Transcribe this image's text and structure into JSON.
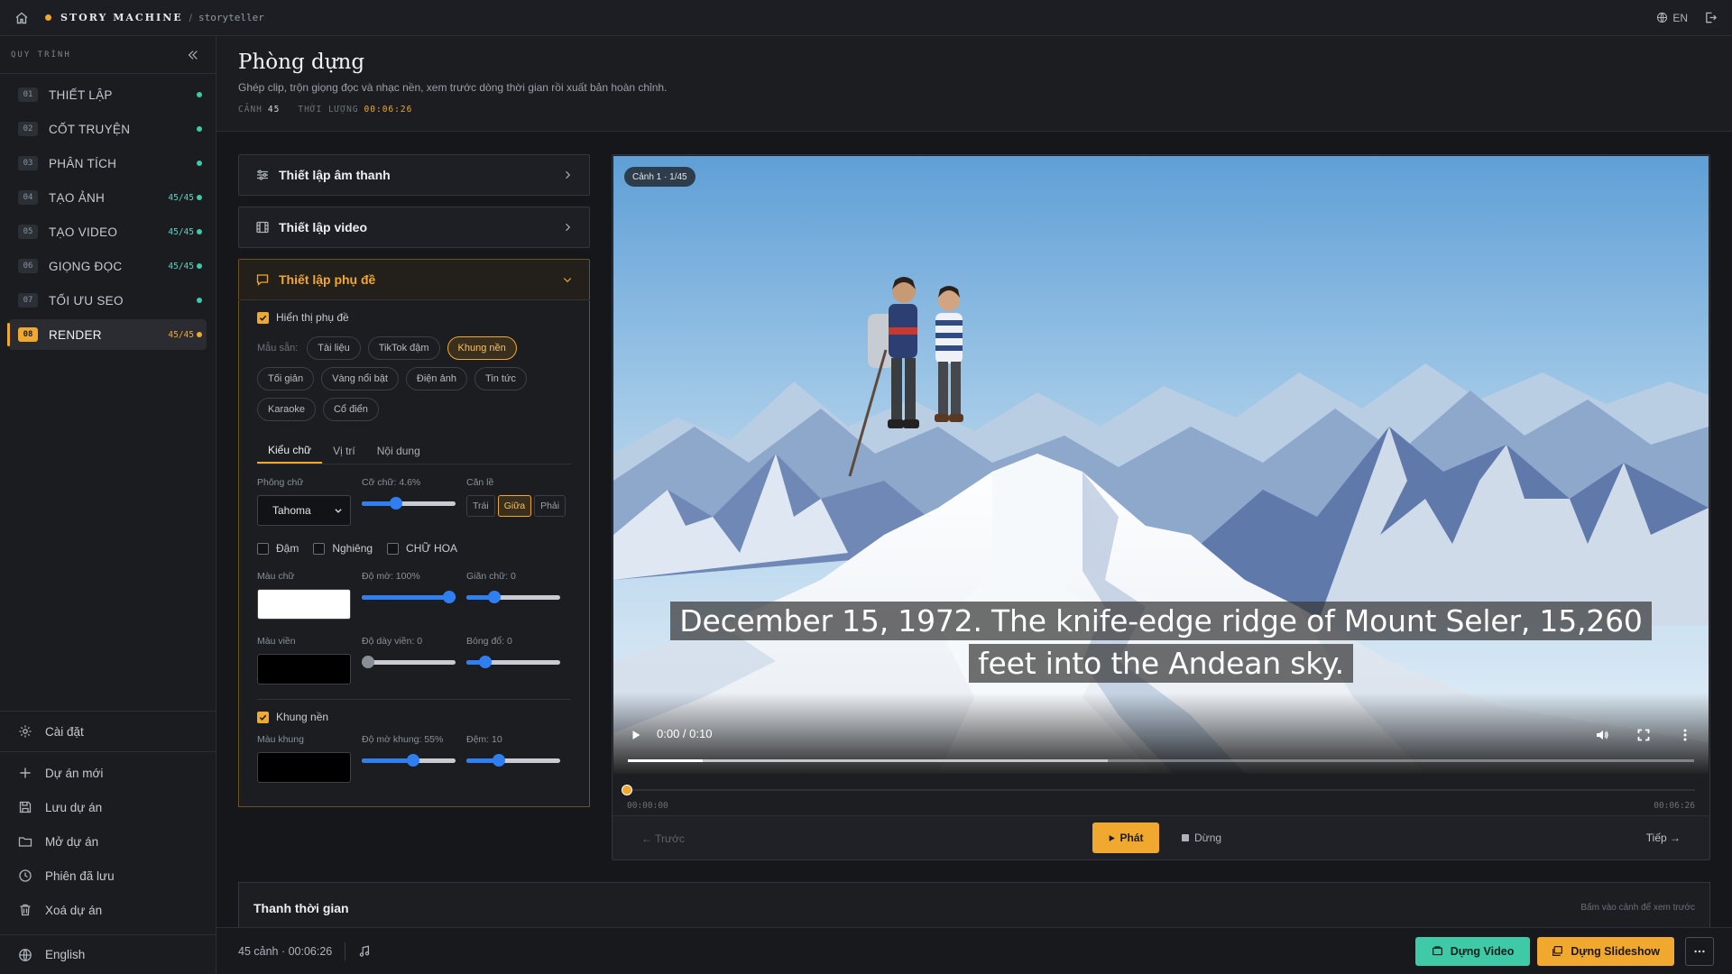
{
  "topbar": {
    "brand": "STORY MACHINE",
    "separator": "/",
    "crumb": "storyteller",
    "language": "EN"
  },
  "sidebar": {
    "heading": "QUY TRÌNH",
    "steps": [
      {
        "num": "01",
        "label": "THIẾT LẬP",
        "count": ""
      },
      {
        "num": "02",
        "label": "CỐT TRUYỆN",
        "count": ""
      },
      {
        "num": "03",
        "label": "PHÂN TÍCH",
        "count": ""
      },
      {
        "num": "04",
        "label": "TẠO ẢNH",
        "count": "45/45"
      },
      {
        "num": "05",
        "label": "TẠO VIDEO",
        "count": "45/45"
      },
      {
        "num": "06",
        "label": "GIỌNG ĐỌC",
        "count": "45/45"
      },
      {
        "num": "07",
        "label": "TỐI ƯU SEO",
        "count": ""
      },
      {
        "num": "08",
        "label": "RENDER",
        "count": "45/45"
      }
    ],
    "settings": "Cài đặt",
    "menu": [
      "Dự án mới",
      "Lưu dự án",
      "Mở dự án",
      "Phiên đã lưu",
      "Xoá dự án"
    ],
    "language": "English"
  },
  "header": {
    "title": "Phòng dựng",
    "subtitle": "Ghép clip, trộn giọng đọc và nhạc nền, xem trước dòng thời gian rồi xuất bản hoàn chỉnh.",
    "scenes_label": "CẢNH",
    "scenes_value": "45",
    "duration_label": "THỜI LƯỢNG",
    "duration_value": "00:06:26"
  },
  "panel": {
    "audio_title": "Thiết lập âm thanh",
    "video_title": "Thiết lập video",
    "subtitle_title": "Thiết lập phụ đề",
    "show_subtitles": "Hiển thị phụ đề",
    "presets_label": "Mẫu sẵn:",
    "presets": [
      "Tài liệu",
      "TikTok đậm",
      "Khung nền",
      "Tối giản",
      "Vàng nổi bật",
      "Điện ảnh",
      "Tin tức",
      "Karaoke",
      "Cổ điển"
    ],
    "tabs": [
      "Kiểu chữ",
      "Vị trí",
      "Nội dung"
    ],
    "font_label": "Phông chữ",
    "font_value": "Tahoma",
    "size_label": "Cỡ chữ: 4.6%",
    "size_value": 0.37,
    "align_label": "Căn lề",
    "align_options": [
      "Trái",
      "Giữa",
      "Phải"
    ],
    "bold": "Đậm",
    "italic": "Nghiêng",
    "uppercase": "CHỮ HOA",
    "text_color_label": "Màu chữ",
    "text_color": "#ffffff",
    "opacity_label": "Độ mờ: 100%",
    "opacity_value": 1.0,
    "spacing_label": "Giãn chữ: 0",
    "spacing_value": 0.3,
    "outline_color_label": "Màu viền",
    "outline_color": "#000000",
    "outline_width_label": "Độ dày viền: 0",
    "outline_width_value": 0.0,
    "shadow_label": "Bóng đổ: 0",
    "shadow_value": 0.2,
    "box_label": "Khung nền",
    "box_color_label": "Màu khung",
    "box_color": "#000000",
    "box_opacity_label": "Độ mờ khung: 55%",
    "box_opacity_value": 0.55,
    "padding_label": "Đệm: 10",
    "padding_value": 0.35
  },
  "preview": {
    "scene_badge": "Cảnh 1 · 1/45",
    "caption_lines": [
      "December 15, 1972. The knife-edge ridge of Mount Seler, 15,260",
      "feet into the Andean sky."
    ],
    "video_time": "0:00 / 0:10",
    "video_buffered": 0.45,
    "video_progress": 0.07,
    "scrub_start": "00:00:00",
    "scrub_end": "00:06:26",
    "prev": "← Trước",
    "play": "Phát",
    "stop": "Dừng",
    "next": "Tiếp →"
  },
  "timeline": {
    "title": "Thanh thời gian",
    "hint": "Bấm vào cảnh để xem trước"
  },
  "footer": {
    "info": "45 cảnh · 00:06:26",
    "build_video": "Dựng Video",
    "build_slideshow": "Dựng Slideshow"
  }
}
